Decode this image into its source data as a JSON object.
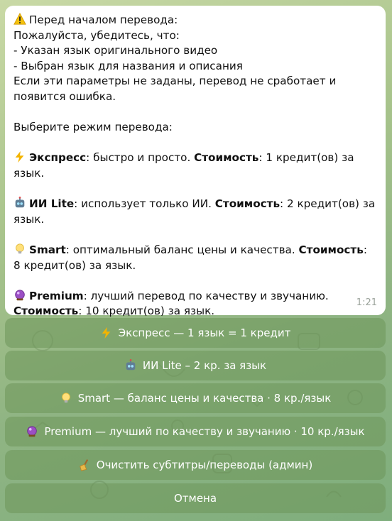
{
  "message": {
    "time": "1:21",
    "intro_title": "Перед началом перевода:",
    "please_check": "Пожалуйста, убедитесь, что:",
    "check_1": "- Указан язык оригинального видео",
    "check_2": "- Выбран язык для названия и описания",
    "warning_1": "Если эти параметры не заданы, перевод не сработает и",
    "warning_2": "появится ошибка.",
    "choose_mode": "Выберите режим перевода:",
    "modes": [
      {
        "icon": "lightning-icon",
        "name": "Экспресс",
        "desc": ": быстро и просто. ",
        "cost_label": "Стоимость",
        "cost_line1": ": 1 кредит(ов) за язык.",
        "cost_line2": ""
      },
      {
        "icon": "robot-icon",
        "name": "ИИ Lite",
        "desc": ": использует только ИИ. ",
        "cost_label": "Стоимость",
        "cost_line1": ": 2 кредит(ов) за",
        "cost_line2": "язык."
      },
      {
        "icon": "lightbulb-icon",
        "name": "Smart",
        "desc": ": оптимальный баланс цены и качества. ",
        "cost_label": "Стоимость",
        "cost_line1": ":",
        "cost_line2": "8 кредит(ов) за язык."
      },
      {
        "icon": "crystal-ball-icon",
        "name": "Premium",
        "desc": ": лучший перевод по качеству и звучанию.",
        "cost_label": "Стоимость",
        "cost_line1": "",
        "cost_line2": ": 10 кредит(ов) за язык."
      }
    ]
  },
  "keyboard": [
    {
      "icon": "lightning-icon",
      "label": "Экспресс — 1 язык = 1 кредит"
    },
    {
      "icon": "robot-icon",
      "label": "ИИ Lite – 2 кр. за язык"
    },
    {
      "icon": "lightbulb-icon",
      "label": "Smart — баланс цены и качества · 8 кр./язык"
    },
    {
      "icon": "crystal-ball-icon",
      "label": "Premium — лучший по качеству и звучанию · 10 кр./язык"
    },
    {
      "icon": "broom-icon",
      "label": "Очистить субтитры/переводы (админ)"
    },
    {
      "icon": "",
      "label": "Отмена"
    }
  ],
  "colors": {
    "bubble_bg": "#ffffff",
    "button_bg": "#6e965a",
    "accent_warning": "#f4c20d",
    "accent_lightning": "#f4b400",
    "accent_premium": "#8e3fb3"
  }
}
